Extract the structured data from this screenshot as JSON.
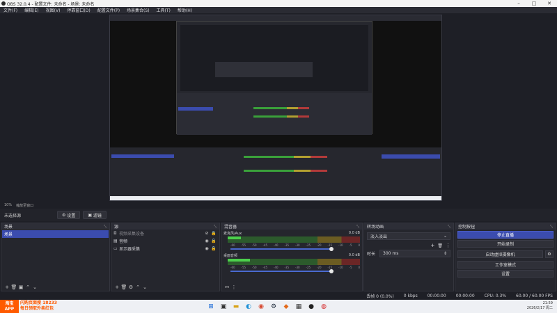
{
  "window": {
    "title": "OBS 32.0.4 - 配置文件: 未命名 - 场景: 未命名"
  },
  "menu": [
    "文件(F)",
    "编辑(E)",
    "视图(V)",
    "停靠窗口(D)",
    "配置文件(P)",
    "场景集合(S)",
    "工具(T)",
    "帮助(H)"
  ],
  "preview_toolbar": {
    "zoom": "10%",
    "fit_label": "缩放至窗口"
  },
  "source_toolbar": {
    "no_selection": "未选择源",
    "settings": "设置",
    "filters": "滤镜"
  },
  "docks": {
    "scenes": {
      "title": "场景",
      "items": [
        "场景"
      ]
    },
    "sources": {
      "title": "源",
      "items": [
        {
          "label": "视频采集设备",
          "icon": "camera-icon"
        },
        {
          "label": "音频",
          "icon": "audio-icon"
        },
        {
          "label": "显示器采集",
          "icon": "monitor-icon"
        }
      ]
    },
    "mixer": {
      "title": "混音器",
      "channels": [
        {
          "name": "麦克风/Aux",
          "db": "0.0 dB",
          "level": 0.1
        },
        {
          "name": "桌面音频",
          "db": "0.0 dB",
          "level": 0.17
        }
      ],
      "ticks": [
        "-60",
        "-55",
        "-50",
        "-45",
        "-40",
        "-35",
        "-30",
        "-25",
        "-20",
        "-15",
        "-10",
        "-5",
        "0"
      ]
    },
    "transitions": {
      "title": "转场动画",
      "type": "淡入淡出",
      "duration_label": "时长",
      "duration": "300 ms"
    },
    "controls": {
      "title": "控制按钮",
      "buttons": [
        "停止直播",
        "开始录制",
        "启动虚拟摄像机",
        "工作室模式",
        "设置"
      ]
    }
  },
  "status": {
    "dropped": "丢帧 0 (0.0%)",
    "bitrate": "0 kbps",
    "stream_time": "00:00:00",
    "rec_time": "00:00:00",
    "cpu": "CPU: 0.3%",
    "fps": "60.00 / 60.00 FPS"
  },
  "taskbar": {
    "ad_line1": "淘宝",
    "ad_line2": "APP",
    "ad_text1": "闪购页面搜 18233",
    "ad_text2": "每日领取外卖红包",
    "time": "21:59",
    "date": "2026/2/17 周二"
  },
  "colors": {
    "accent": "#3b4cae",
    "bg": "#1e1f26",
    "panel": "#25262d"
  }
}
